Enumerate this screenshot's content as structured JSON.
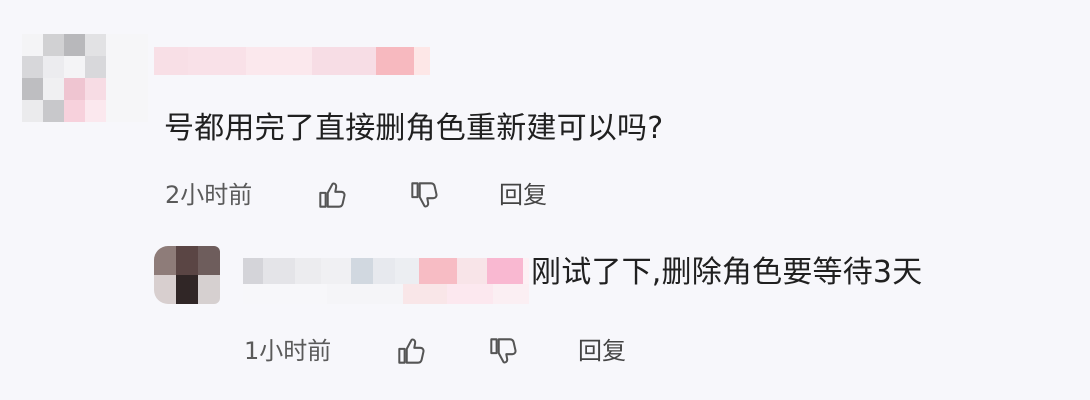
{
  "comments": {
    "main": {
      "text": "号都用完了直接删角色重新建可以吗?",
      "time": "2小时前",
      "reply_label": "回复",
      "avatar_icon": "blurred-avatar-icon",
      "username_icon": "blurred-username-icon"
    },
    "reply": {
      "text": "刚试了下,删除角色要等待3天",
      "time": "1小时前",
      "reply_label": "回复",
      "avatar_icon": "blurred-avatar-icon",
      "username_icon": "blurred-username-icon"
    }
  },
  "icons": {
    "like": "thumbs-up-icon",
    "dislike": "thumbs-down-icon"
  },
  "colors": {
    "background": "#f7f7fb",
    "text": "#202020",
    "meta": "#5a5a5a",
    "mosaic_pink": "#f7a6b8",
    "mosaic_gray": "#c8c8cc",
    "mosaic_dark": "#3f3433"
  }
}
